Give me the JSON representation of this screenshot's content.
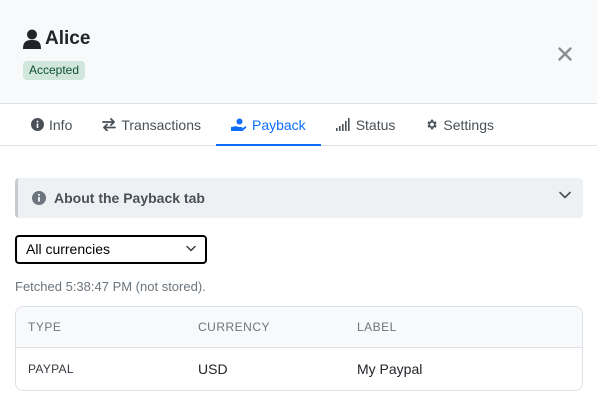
{
  "header": {
    "user_name": "Alice",
    "status_badge": "Accepted",
    "status_color": "#d1e7dd",
    "icons": {
      "user": "user-icon",
      "close": "close-icon"
    }
  },
  "tabs": [
    {
      "label": "Info",
      "icon": "info-circle-icon",
      "active": false
    },
    {
      "label": "Transactions",
      "icon": "arrows-exchange-icon",
      "active": false
    },
    {
      "label": "Payback",
      "icon": "hand-holding-coin-icon",
      "active": true
    },
    {
      "label": "Status",
      "icon": "signal-bars-icon",
      "active": false
    },
    {
      "label": "Settings",
      "icon": "gear-icon",
      "active": false
    }
  ],
  "accent_color": "#0d6efd",
  "accordion": {
    "title": "About the Payback tab",
    "icon": "info-circle-icon",
    "expanded": false
  },
  "currency_filter": {
    "selected": "All currencies"
  },
  "fetched_text": "Fetched 5:38:47 PM (not stored).",
  "table": {
    "columns": [
      "TYPE",
      "CURRENCY",
      "LABEL"
    ],
    "rows": [
      {
        "type": "PAYPAL",
        "currency": "USD",
        "label": "My Paypal"
      }
    ]
  }
}
